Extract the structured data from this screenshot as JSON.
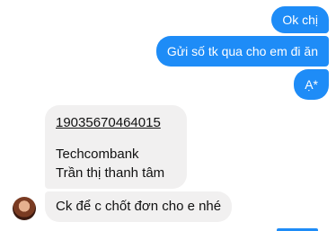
{
  "messages": {
    "outgoing": [
      {
        "text": "Ok chị"
      },
      {
        "text": "Gửi số tk qua cho em đi ăn"
      },
      {
        "text": "Ạ*"
      }
    ],
    "incoming": {
      "account_number": "19035670464015",
      "bank": "Techcombank",
      "account_name": "Trần thị thanh tâm",
      "followup": "Ck để c chốt đơn cho e nhé"
    }
  },
  "colors": {
    "outgoing_bubble": "#1e8cf7",
    "incoming_bubble": "#f1f0f0"
  },
  "icons": {
    "avatar": "contact-avatar"
  }
}
